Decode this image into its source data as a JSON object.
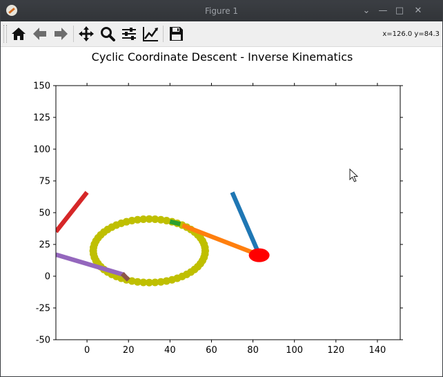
{
  "window": {
    "title": "Figure 1"
  },
  "toolbar": {
    "buttons": [
      {
        "name": "home",
        "icon": "home-icon"
      },
      {
        "name": "back",
        "icon": "arrow-left-icon"
      },
      {
        "name": "forward",
        "icon": "arrow-right-icon"
      },
      {
        "name": "pan",
        "icon": "move-icon"
      },
      {
        "name": "zoom",
        "icon": "magnifier-icon"
      },
      {
        "name": "subplots",
        "icon": "sliders-icon"
      },
      {
        "name": "edit-axes",
        "icon": "line-chart-icon"
      },
      {
        "name": "save",
        "icon": "floppy-disk-icon"
      }
    ],
    "coordinates": "x=126.0 y=84.3"
  },
  "chart_data": {
    "type": "line",
    "title": "Cyclic Coordinate Descent - Inverse Kinematics",
    "xlabel": "",
    "ylabel": "",
    "xlim": [
      -15,
      151
    ],
    "ylim": [
      -50,
      150
    ],
    "xticks": [
      0,
      20,
      40,
      60,
      80,
      100,
      120,
      140
    ],
    "yticks": [
      150,
      125,
      100,
      75,
      50,
      25,
      0,
      -25,
      -50
    ],
    "grid": false,
    "legend": "none",
    "target_path": {
      "color": "#bfbf00",
      "shape": "ellipse",
      "center": [
        30,
        20
      ],
      "radius_x": 27,
      "radius_y": 25
    },
    "series": [
      {
        "color": "#d62728",
        "x": [
          -15,
          0
        ],
        "y": [
          35,
          66
        ]
      },
      {
        "color": "#9467bd",
        "x": [
          -15,
          18
        ],
        "y": [
          17,
          1
        ]
      },
      {
        "color": "#8c564b",
        "x": [
          17,
          20
        ],
        "y": [
          2,
          -3
        ]
      },
      {
        "color": "#1f77b4",
        "x": [
          70,
          82.5
        ],
        "y": [
          66,
          19
        ]
      },
      {
        "color": "#ff7f0e",
        "x": [
          46,
          82.5
        ],
        "y": [
          40,
          17
        ]
      },
      {
        "color": "#2ca02c",
        "x": [
          40,
          45
        ],
        "y": [
          43,
          41
        ]
      }
    ],
    "base_marker": {
      "color": "#ff0000",
      "x": 83,
      "y": 16.5
    }
  }
}
